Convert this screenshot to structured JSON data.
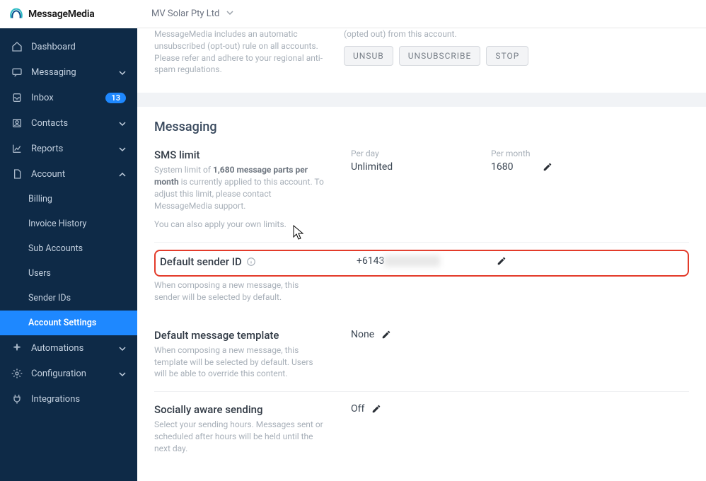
{
  "brand": "MessageMedia",
  "org_name": "MV Solar Pty Ltd",
  "sidebar": {
    "items": [
      {
        "icon": "home-icon",
        "label": "Dashboard",
        "expandable": false
      },
      {
        "icon": "chat-icon",
        "label": "Messaging",
        "expandable": true
      },
      {
        "icon": "inbox-icon",
        "label": "Inbox",
        "badge": "13",
        "expandable": false
      },
      {
        "icon": "contacts-icon",
        "label": "Contacts",
        "expandable": true
      },
      {
        "icon": "chart-icon",
        "label": "Reports",
        "expandable": true
      },
      {
        "icon": "file-icon",
        "label": "Account",
        "expandable": true,
        "open": true,
        "sub": [
          {
            "label": "Billing"
          },
          {
            "label": "Invoice History"
          },
          {
            "label": "Sub Accounts"
          },
          {
            "label": "Users"
          },
          {
            "label": "Sender IDs"
          },
          {
            "label": "Account Settings",
            "active": true
          }
        ]
      },
      {
        "icon": "sparkle-icon",
        "label": "Automations",
        "expandable": true
      },
      {
        "icon": "gear-icon",
        "label": "Configuration",
        "expandable": true
      },
      {
        "icon": "plug-icon",
        "label": "Integrations",
        "expandable": false
      }
    ]
  },
  "opt_out": {
    "desc": "MessageMedia includes an automatic unsubscribed (opt-out) rule on all accounts. Please refer and adhere to your regional anti-spam regulations.",
    "sub_desc": "(opted out) from this account.",
    "pills": [
      "UNSUB",
      "UNSUBSCRIBE",
      "STOP"
    ]
  },
  "messaging": {
    "title": "Messaging",
    "sms_limit": {
      "heading": "SMS limit",
      "desc_pre": "System limit of ",
      "desc_bold": "1,680 message parts per month",
      "desc_post": " is currently applied to this account. To adjust this limit, please contact MessageMedia support.",
      "desc2": "You can also apply your own limits.",
      "per_day_label": "Per day",
      "per_day_value": "Unlimited",
      "per_month_label": "Per month",
      "per_month_value": "1680"
    },
    "default_sender": {
      "heading": "Default sender ID",
      "desc": "When composing a new message, this sender will be selected by default.",
      "value_prefix": "+6143",
      "value_hidden": "XXXXXXXX"
    },
    "default_template": {
      "heading": "Default message template",
      "desc": "When composing a new message, this template will be selected by default. Users will be able to override this content.",
      "value": "None"
    },
    "socially_aware": {
      "heading": "Socially aware sending",
      "desc": "Select your sending hours. Messages sent or scheduled after hours will be held until the next day.",
      "value": "Off"
    }
  }
}
